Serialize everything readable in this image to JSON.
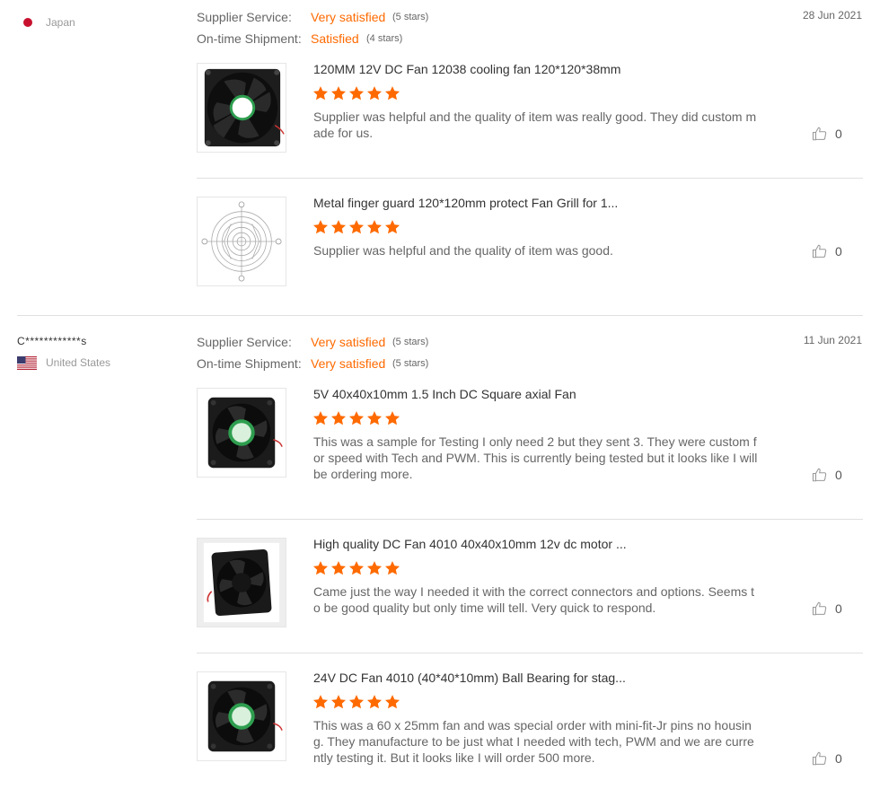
{
  "rating_labels": {
    "supplier": "Supplier Service:",
    "shipment": "On-time Shipment:"
  },
  "colors": {
    "accent": "#ff6a00",
    "star": "#ff6a00"
  },
  "reviews": [
    {
      "buyer": "",
      "country": "Japan",
      "date": "28 Jun 2021",
      "supplier_value": "Very satisfied",
      "supplier_stars": "(5 stars)",
      "shipment_value": "Satisfied",
      "shipment_stars": "(4 stars)",
      "items": [
        {
          "title": "120MM 12V DC Fan 12038 cooling fan 120*120*38mm",
          "rating": 5,
          "text": "Supplier was helpful and the quality of item was really good. They did custom made for us.",
          "likes": "0"
        },
        {
          "title": "Metal finger guard 120*120mm protect Fan Grill for 1...",
          "rating": 5,
          "text": "Supplier was helpful and the quality of item was good.",
          "likes": "0"
        }
      ]
    },
    {
      "buyer": "C************s",
      "country": "United States",
      "date": "11 Jun 2021",
      "supplier_value": "Very satisfied",
      "supplier_stars": "(5 stars)",
      "shipment_value": "Very satisfied",
      "shipment_stars": "(5 stars)",
      "items": [
        {
          "title": "5V 40x40x10mm 1.5 Inch DC Square axial Fan",
          "rating": 5,
          "text": "This was a sample for Testing I only need 2 but they sent 3. They were custom for speed with Tech and PWM. This is currently being tested but it looks like I will be ordering more.",
          "likes": "0"
        },
        {
          "title": "High quality DC Fan 4010 40x40x10mm 12v dc motor ...",
          "rating": 5,
          "text": "Came just the way I needed it with the correct connectors and options. Seems to be good quality but only time will tell. Very quick to respond.",
          "likes": "0"
        },
        {
          "title": "24V DC Fan 4010 (40*40*10mm) Ball Bearing for stag...",
          "rating": 5,
          "text": "This was a 60 x 25mm fan and was special order with mini-fit-Jr pins no housing. They manufacture to be just what I needed with tech, PWM and we are currently testing it. But it looks like I will order 500 more.",
          "likes": "0"
        }
      ]
    }
  ]
}
